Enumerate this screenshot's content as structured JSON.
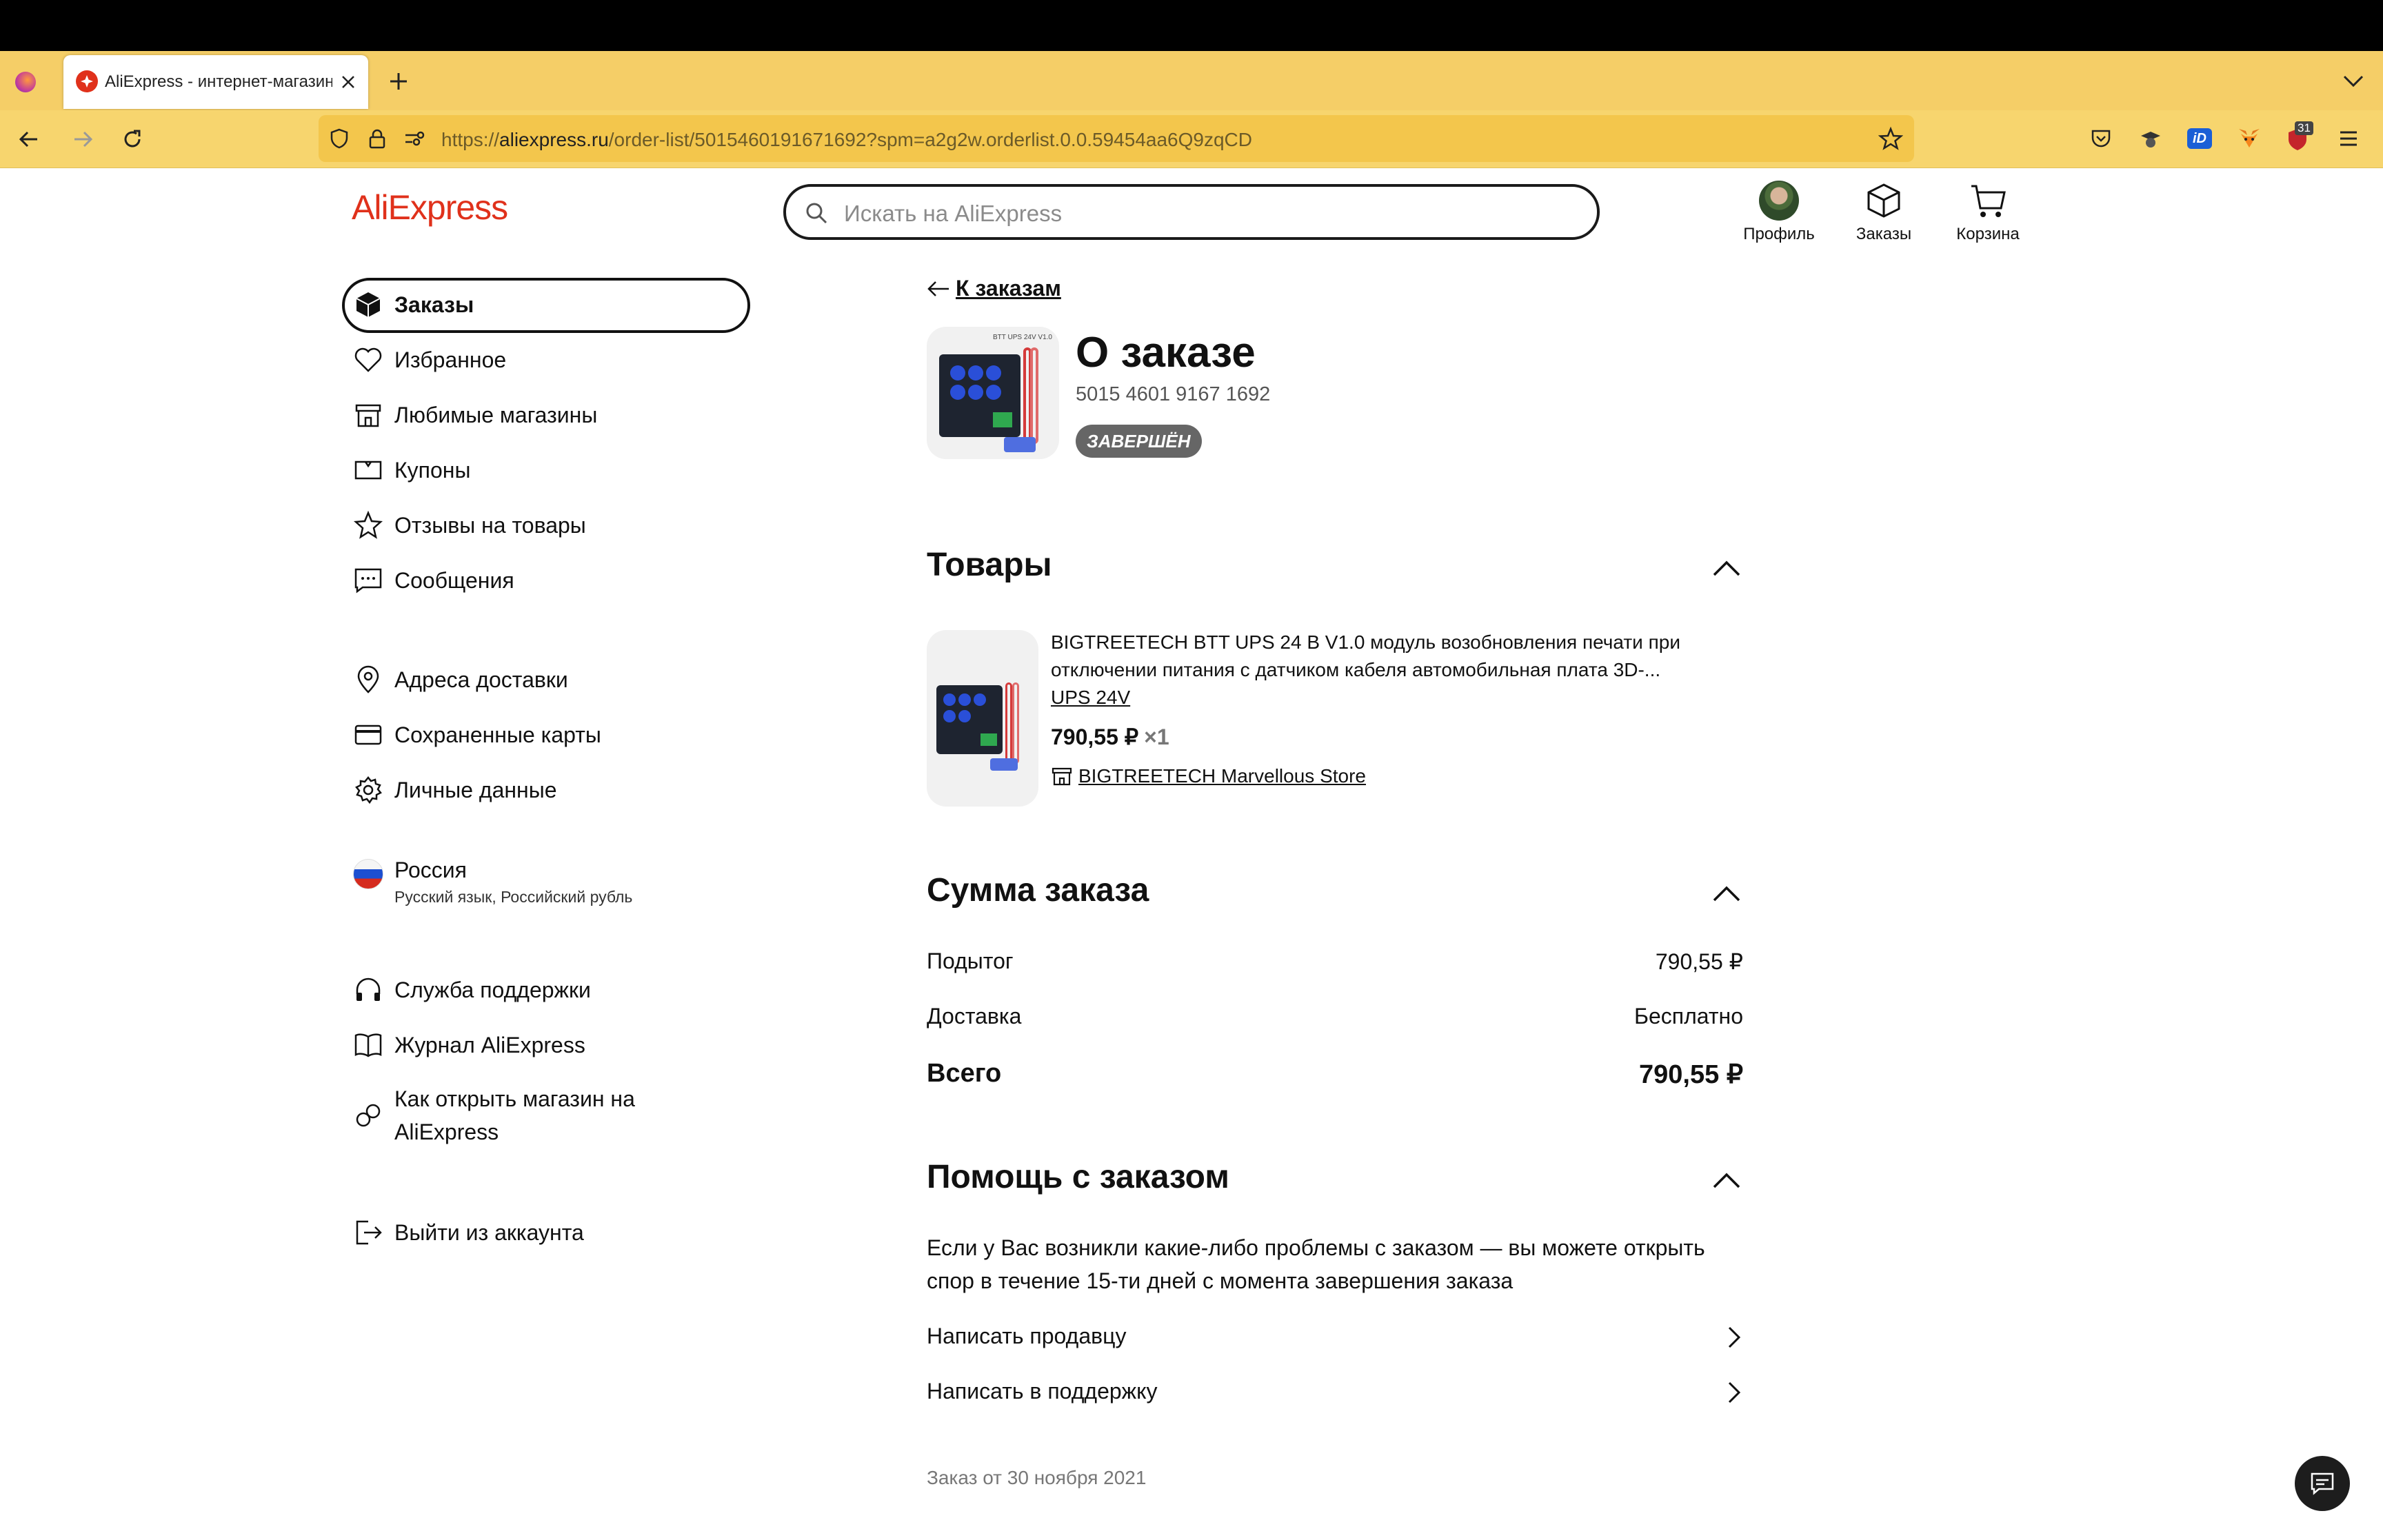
{
  "browser": {
    "tab_title": "AliExpress - интернет-магазин",
    "url_prefix": "https://",
    "url_host": "aliexpress.ru",
    "url_path": "/order-list/5015460191671692?spm=a2g2w.orderlist.0.0.59454aa6Q9zqCD",
    "extension_badge": "31"
  },
  "header": {
    "logo": "AliExpress",
    "search_placeholder": "Искать на AliExpress",
    "profile_label": "Профиль",
    "orders_label": "Заказы",
    "cart_label": "Корзина"
  },
  "sidebar": {
    "items": [
      {
        "label": "Заказы",
        "icon": "box-icon"
      },
      {
        "label": "Избранное",
        "icon": "heart-icon"
      },
      {
        "label": "Любимые магазины",
        "icon": "store-icon"
      },
      {
        "label": "Купоны",
        "icon": "coupon-icon"
      },
      {
        "label": "Отзывы на товары",
        "icon": "star-icon"
      },
      {
        "label": "Сообщения",
        "icon": "message-icon"
      },
      {
        "label": "Адреса доставки",
        "icon": "location-icon"
      },
      {
        "label": "Сохраненные карты",
        "icon": "card-icon"
      },
      {
        "label": "Личные данные",
        "icon": "gear-icon"
      },
      {
        "label": "Служба поддержки",
        "icon": "headphones-icon"
      },
      {
        "label": "Журнал AliExpress",
        "icon": "book-icon"
      },
      {
        "label": "Как открыть магазин на AliExpress",
        "icon": "link-icon"
      },
      {
        "label": "Выйти из аккаунта",
        "icon": "logout-icon"
      }
    ],
    "region": {
      "country": "Россия",
      "details": "Русский язык, Российский рубль"
    }
  },
  "order": {
    "back_label": "К заказам",
    "title": "О заказе",
    "number": "5015 4601 9167 1692",
    "status": "ЗАВЕРШЁН",
    "image_label": "BTT UPS 24V V1.0"
  },
  "products": {
    "section_title": "Товары",
    "item": {
      "title": "BIGTREETECH BTT UPS 24 В V1.0 модуль возобновления печати при отключении питания с датчиком кабеля автомобильная плата 3D-...",
      "variant": "UPS 24V",
      "price": "790,55 ₽",
      "qty": "×1",
      "store": "BIGTREETECH Marvellous Store"
    }
  },
  "summary": {
    "section_title": "Сумма заказа",
    "subtotal_label": "Подытог",
    "subtotal_value": "790,55 ₽",
    "delivery_label": "Доставка",
    "delivery_value": "Бесплатно",
    "total_label": "Всего",
    "total_value": "790,55 ₽"
  },
  "help": {
    "section_title": "Помощь с заказом",
    "text": "Если у Вас возникли какие-либо проблемы с заказом — вы можете открыть спор в течение 15-ти дней с момента завершения заказа",
    "contact_seller": "Написать продавцу",
    "contact_support": "Написать в поддержку"
  },
  "footer": {
    "order_date": "Заказ от 30 ноября 2021"
  },
  "colors": {
    "brand": "#e0311b",
    "tabbar": "#f5ce67",
    "status_badge": "#666666"
  }
}
